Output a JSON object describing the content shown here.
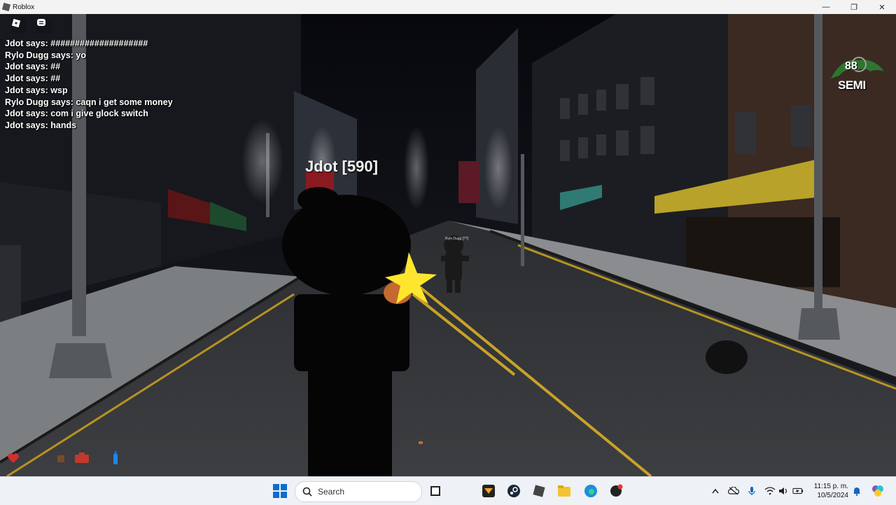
{
  "window": {
    "title": "Roblox",
    "minimize": "—",
    "maximize": "❐",
    "close": "✕"
  },
  "chat": [
    "Jdot says: ####################",
    "Rylo Dugg says: yo",
    "Jdot says: ##",
    "Jdot says: ##",
    "Jdot says: wsp",
    "Rylo Dugg says: caqn i get some money",
    "Jdot says: com i give glock switch",
    "Jdot says: hands"
  ],
  "world": {
    "player_nametag": "Jdot [590]",
    "enemy_nametag": "Rylo Dugg [??]"
  },
  "logo": {
    "number": "88",
    "label": "SEMI"
  },
  "taskbar": {
    "search_placeholder": "Search",
    "time": "11:15 p. m.",
    "date": "10/5/2024"
  },
  "colors": {
    "road_line": "#c9a227",
    "awning": "#c8b22a",
    "taskbar": "#eef1f6"
  }
}
